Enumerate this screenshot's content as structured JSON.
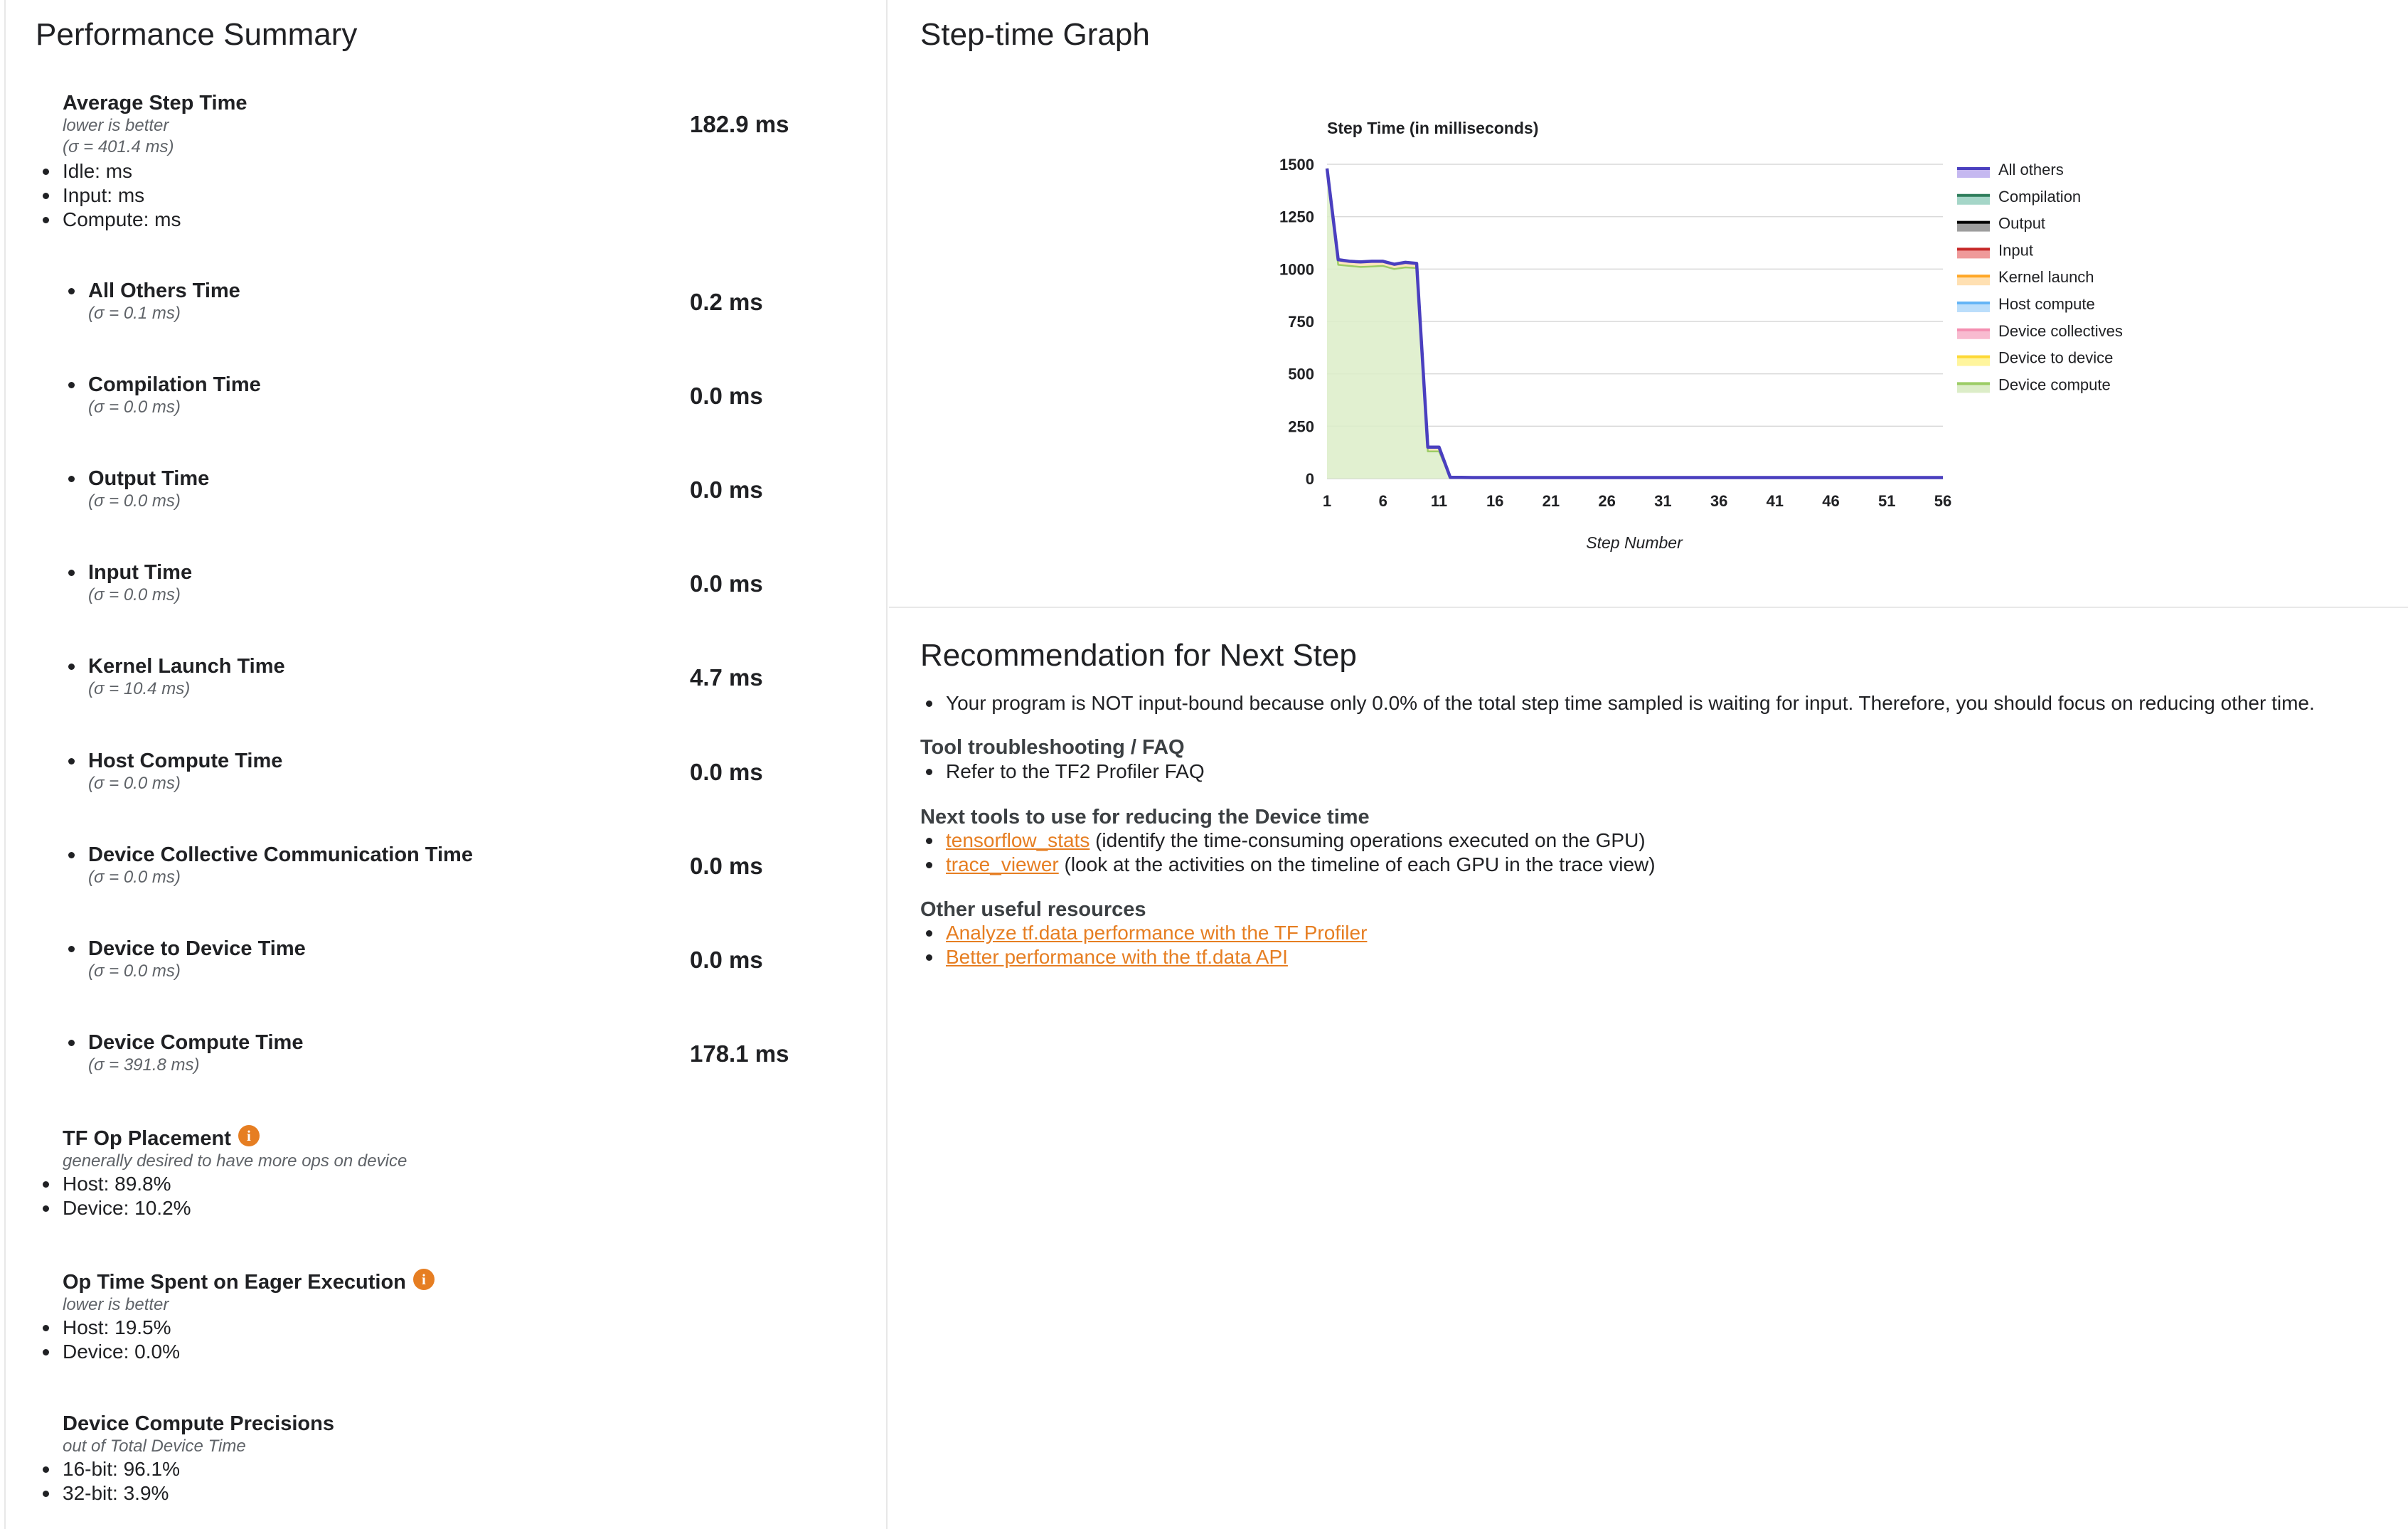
{
  "performance_summary": {
    "title": "Performance Summary",
    "average_step_time": {
      "label": "Average Step Time",
      "note": "lower is better",
      "sigma": "(σ = 401.4 ms)",
      "value": "182.9 ms",
      "breakdown": [
        "Idle: ms",
        "Input: ms",
        "Compute: ms"
      ]
    },
    "metrics": [
      {
        "label": "All Others Time",
        "sigma": "(σ = 0.1 ms)",
        "value": "0.2 ms"
      },
      {
        "label": "Compilation Time",
        "sigma": "(σ = 0.0 ms)",
        "value": "0.0 ms"
      },
      {
        "label": "Output Time",
        "sigma": "(σ = 0.0 ms)",
        "value": "0.0 ms"
      },
      {
        "label": "Input Time",
        "sigma": "(σ = 0.0 ms)",
        "value": "0.0 ms"
      },
      {
        "label": "Kernel Launch Time",
        "sigma": "(σ = 10.4 ms)",
        "value": "4.7 ms"
      },
      {
        "label": "Host Compute Time",
        "sigma": "(σ = 0.0 ms)",
        "value": "0.0 ms"
      },
      {
        "label": "Device Collective Communication Time",
        "sigma": "(σ = 0.0 ms)",
        "value": "0.0 ms"
      },
      {
        "label": "Device to Device Time",
        "sigma": "(σ = 0.0 ms)",
        "value": "0.0 ms"
      },
      {
        "label": "Device Compute Time",
        "sigma": "(σ = 391.8 ms)",
        "value": "178.1 ms"
      }
    ],
    "tf_op_placement": {
      "label": "TF Op Placement",
      "note": "generally desired to have more ops on device",
      "items": [
        "Host: 89.8%",
        "Device: 10.2%"
      ]
    },
    "eager_execution": {
      "label": "Op Time Spent on Eager Execution",
      "note": "lower is better",
      "items": [
        "Host: 19.5%",
        "Device: 0.0%"
      ]
    },
    "precisions": {
      "label": "Device Compute Precisions",
      "note": "out of Total Device Time",
      "items": [
        "16-bit: 96.1%",
        "32-bit: 3.9%"
      ]
    }
  },
  "step_time_graph": {
    "title": "Step-time Graph"
  },
  "chart_data": {
    "type": "area",
    "title": "Step Time (in milliseconds)",
    "xlabel": "Step Number",
    "ylabel": "",
    "x_ticks": [
      "1",
      "6",
      "11",
      "16",
      "21",
      "26",
      "31",
      "36",
      "41",
      "46",
      "51",
      "56"
    ],
    "y_ticks": [
      "0",
      "250",
      "500",
      "750",
      "1000",
      "1250",
      "1500"
    ],
    "xlim": [
      1,
      56
    ],
    "ylim": [
      0,
      1500
    ],
    "stacked": true,
    "legend_position": "right",
    "x": [
      1,
      2,
      3,
      4,
      5,
      6,
      7,
      8,
      9,
      10,
      11,
      12,
      13,
      14,
      15,
      16,
      17,
      18,
      19,
      20,
      21,
      22,
      23,
      24,
      25,
      26,
      27,
      28,
      29,
      30,
      31,
      32,
      33,
      34,
      35,
      36,
      37,
      38,
      39,
      40,
      41,
      42,
      43,
      44,
      45,
      46,
      47,
      48,
      49,
      50,
      51,
      52,
      53,
      54,
      55,
      56
    ],
    "series": [
      {
        "name": "Device compute",
        "color": "#dcedc8",
        "line_color": "#9ccc65",
        "values": [
          1480,
          1020,
          1015,
          1010,
          1012,
          1015,
          1000,
          1008,
          1005,
          130,
          130,
          5,
          5,
          4,
          4,
          4,
          4,
          4,
          4,
          4,
          4,
          4,
          4,
          4,
          4,
          4,
          4,
          4,
          4,
          4,
          4,
          4,
          4,
          4,
          4,
          4,
          4,
          4,
          4,
          4,
          4,
          4,
          4,
          4,
          4,
          4,
          4,
          4,
          4,
          4,
          4,
          4,
          4,
          4,
          4,
          4
        ]
      },
      {
        "name": "Device to device",
        "color": "#fff59d",
        "line_color": "#fdd835",
        "values": [
          0,
          0,
          0,
          0,
          0,
          0,
          0,
          0,
          0,
          0,
          0,
          0,
          0,
          0,
          0,
          0,
          0,
          0,
          0,
          0,
          0,
          0,
          0,
          0,
          0,
          0,
          0,
          0,
          0,
          0,
          0,
          0,
          0,
          0,
          0,
          0,
          0,
          0,
          0,
          0,
          0,
          0,
          0,
          0,
          0,
          0,
          0,
          0,
          0,
          0,
          0,
          0,
          0,
          0,
          0,
          0
        ]
      },
      {
        "name": "Device collectives",
        "color": "#f8bbd0",
        "line_color": "#f48fb1",
        "values": [
          0,
          0,
          0,
          0,
          0,
          0,
          0,
          0,
          0,
          0,
          0,
          0,
          0,
          0,
          0,
          0,
          0,
          0,
          0,
          0,
          0,
          0,
          0,
          0,
          0,
          0,
          0,
          0,
          0,
          0,
          0,
          0,
          0,
          0,
          0,
          0,
          0,
          0,
          0,
          0,
          0,
          0,
          0,
          0,
          0,
          0,
          0,
          0,
          0,
          0,
          0,
          0,
          0,
          0,
          0,
          0
        ]
      },
      {
        "name": "Host compute",
        "color": "#bbdefb",
        "line_color": "#64b5f6",
        "values": [
          0,
          0,
          0,
          0,
          0,
          0,
          0,
          0,
          0,
          0,
          0,
          0,
          0,
          0,
          0,
          0,
          0,
          0,
          0,
          0,
          0,
          0,
          0,
          0,
          0,
          0,
          0,
          0,
          0,
          0,
          0,
          0,
          0,
          0,
          0,
          0,
          0,
          0,
          0,
          0,
          0,
          0,
          0,
          0,
          0,
          0,
          0,
          0,
          0,
          0,
          0,
          0,
          0,
          0,
          0,
          0
        ]
      },
      {
        "name": "Kernel launch",
        "color": "#ffe0b2",
        "line_color": "#ffa726",
        "values": [
          0,
          25,
          22,
          24,
          25,
          22,
          23,
          24,
          22,
          20,
          20,
          1,
          1,
          1,
          1,
          1,
          1,
          1,
          1,
          1,
          1,
          1,
          1,
          1,
          1,
          1,
          1,
          1,
          1,
          1,
          1,
          1,
          1,
          1,
          1,
          1,
          1,
          1,
          1,
          1,
          1,
          1,
          1,
          1,
          1,
          1,
          1,
          1,
          1,
          1,
          1,
          1,
          1,
          1,
          1,
          1
        ]
      },
      {
        "name": "Input",
        "color": "#ef9a9a",
        "line_color": "#c62828",
        "values": [
          0,
          0,
          0,
          0,
          0,
          0,
          0,
          0,
          0,
          0,
          0,
          0,
          0,
          0,
          0,
          0,
          0,
          0,
          0,
          0,
          0,
          0,
          0,
          0,
          0,
          0,
          0,
          0,
          0,
          0,
          0,
          0,
          0,
          0,
          0,
          0,
          0,
          0,
          0,
          0,
          0,
          0,
          0,
          0,
          0,
          0,
          0,
          0,
          0,
          0,
          0,
          0,
          0,
          0,
          0,
          0
        ]
      },
      {
        "name": "Output",
        "color": "#9e9e9e",
        "line_color": "#000000",
        "values": [
          0,
          0,
          0,
          0,
          0,
          0,
          0,
          0,
          0,
          0,
          0,
          0,
          0,
          0,
          0,
          0,
          0,
          0,
          0,
          0,
          0,
          0,
          0,
          0,
          0,
          0,
          0,
          0,
          0,
          0,
          0,
          0,
          0,
          0,
          0,
          0,
          0,
          0,
          0,
          0,
          0,
          0,
          0,
          0,
          0,
          0,
          0,
          0,
          0,
          0,
          0,
          0,
          0,
          0,
          0,
          0
        ]
      },
      {
        "name": "Compilation",
        "color": "#a5d6c8",
        "line_color": "#2e7d5b",
        "values": [
          0,
          0,
          0,
          0,
          0,
          0,
          0,
          0,
          0,
          0,
          0,
          0,
          0,
          0,
          0,
          0,
          0,
          0,
          0,
          0,
          0,
          0,
          0,
          0,
          0,
          0,
          0,
          0,
          0,
          0,
          0,
          0,
          0,
          0,
          0,
          0,
          0,
          0,
          0,
          0,
          0,
          0,
          0,
          0,
          0,
          0,
          0,
          0,
          0,
          0,
          0,
          0,
          0,
          0,
          0,
          0
        ]
      },
      {
        "name": "All others",
        "color": "#c5b8f0",
        "line_color": "#4a3fbf",
        "values": [
          0,
          0,
          0,
          0,
          0,
          0,
          0,
          0,
          0,
          0,
          0,
          0,
          0,
          0,
          0,
          0,
          0,
          0,
          0,
          0,
          0,
          0,
          0,
          0,
          0,
          0,
          0,
          0,
          0,
          0,
          0,
          0,
          0,
          0,
          0,
          0,
          0,
          0,
          0,
          0,
          0,
          0,
          0,
          0,
          0,
          0,
          0,
          0,
          0,
          0,
          0,
          0,
          0,
          0,
          0,
          0
        ]
      }
    ],
    "legend": [
      "All others",
      "Compilation",
      "Output",
      "Input",
      "Kernel launch",
      "Host compute",
      "Device collectives",
      "Device to device",
      "Device compute"
    ]
  },
  "recommendation": {
    "title": "Recommendation for Next Step",
    "summary": "Your program is NOT input-bound because only 0.0% of the total step time sampled is waiting for input. Therefore, you should focus on reducing other time.",
    "faq_heading": "Tool troubleshooting / FAQ",
    "faq_item": "Refer to the TF2 Profiler FAQ",
    "tools_heading": "Next tools to use for reducing the Device time",
    "tools": [
      {
        "link": "tensorflow_stats",
        "desc": " (identify the time-consuming operations executed on the GPU)"
      },
      {
        "link": "trace_viewer",
        "desc": " (look at the activities on the timeline of each GPU in the trace view)"
      }
    ],
    "resources_heading": "Other useful resources",
    "resources": [
      "Analyze tf.data performance with the TF Profiler",
      "Better performance with the tf.data API"
    ]
  },
  "colors": {
    "accent": "#e67e22",
    "info_icon": "#e67e22",
    "grid": "#d9d9d9",
    "border": "#e8e8e8"
  },
  "icons": {
    "info": "info-icon"
  }
}
